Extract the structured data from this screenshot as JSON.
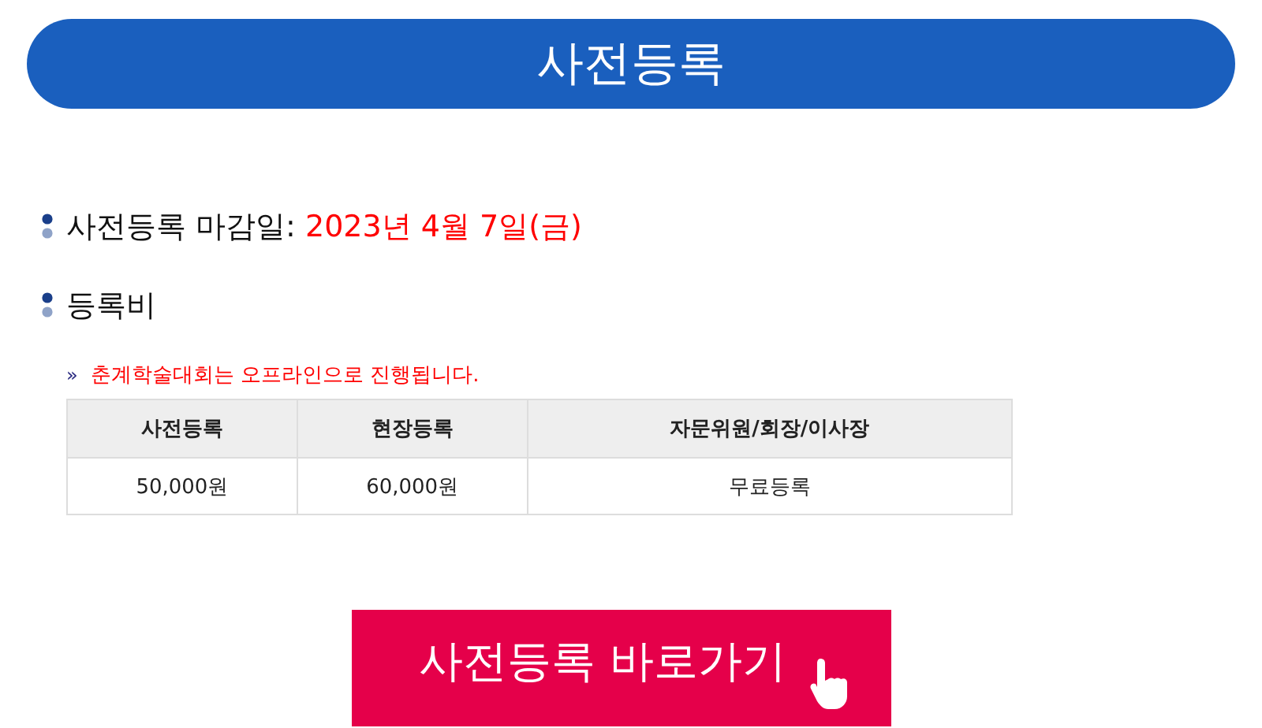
{
  "header": {
    "title": "사전등록"
  },
  "sections": [
    {
      "label": "사전등록 마감일:",
      "value": "2023년 4월 7일(금)"
    },
    {
      "label": "등록비"
    }
  ],
  "notice": {
    "marker": "»",
    "text": "춘계학술대회는 오프라인으로 진행됩니다."
  },
  "table": {
    "columns": [
      "사전등록",
      "현장등록",
      "자문위원/회장/이사장"
    ],
    "rows": [
      [
        "50,000원",
        "60,000원",
        "무료등록"
      ]
    ]
  },
  "cta": {
    "label": "사전등록 바로가기"
  }
}
